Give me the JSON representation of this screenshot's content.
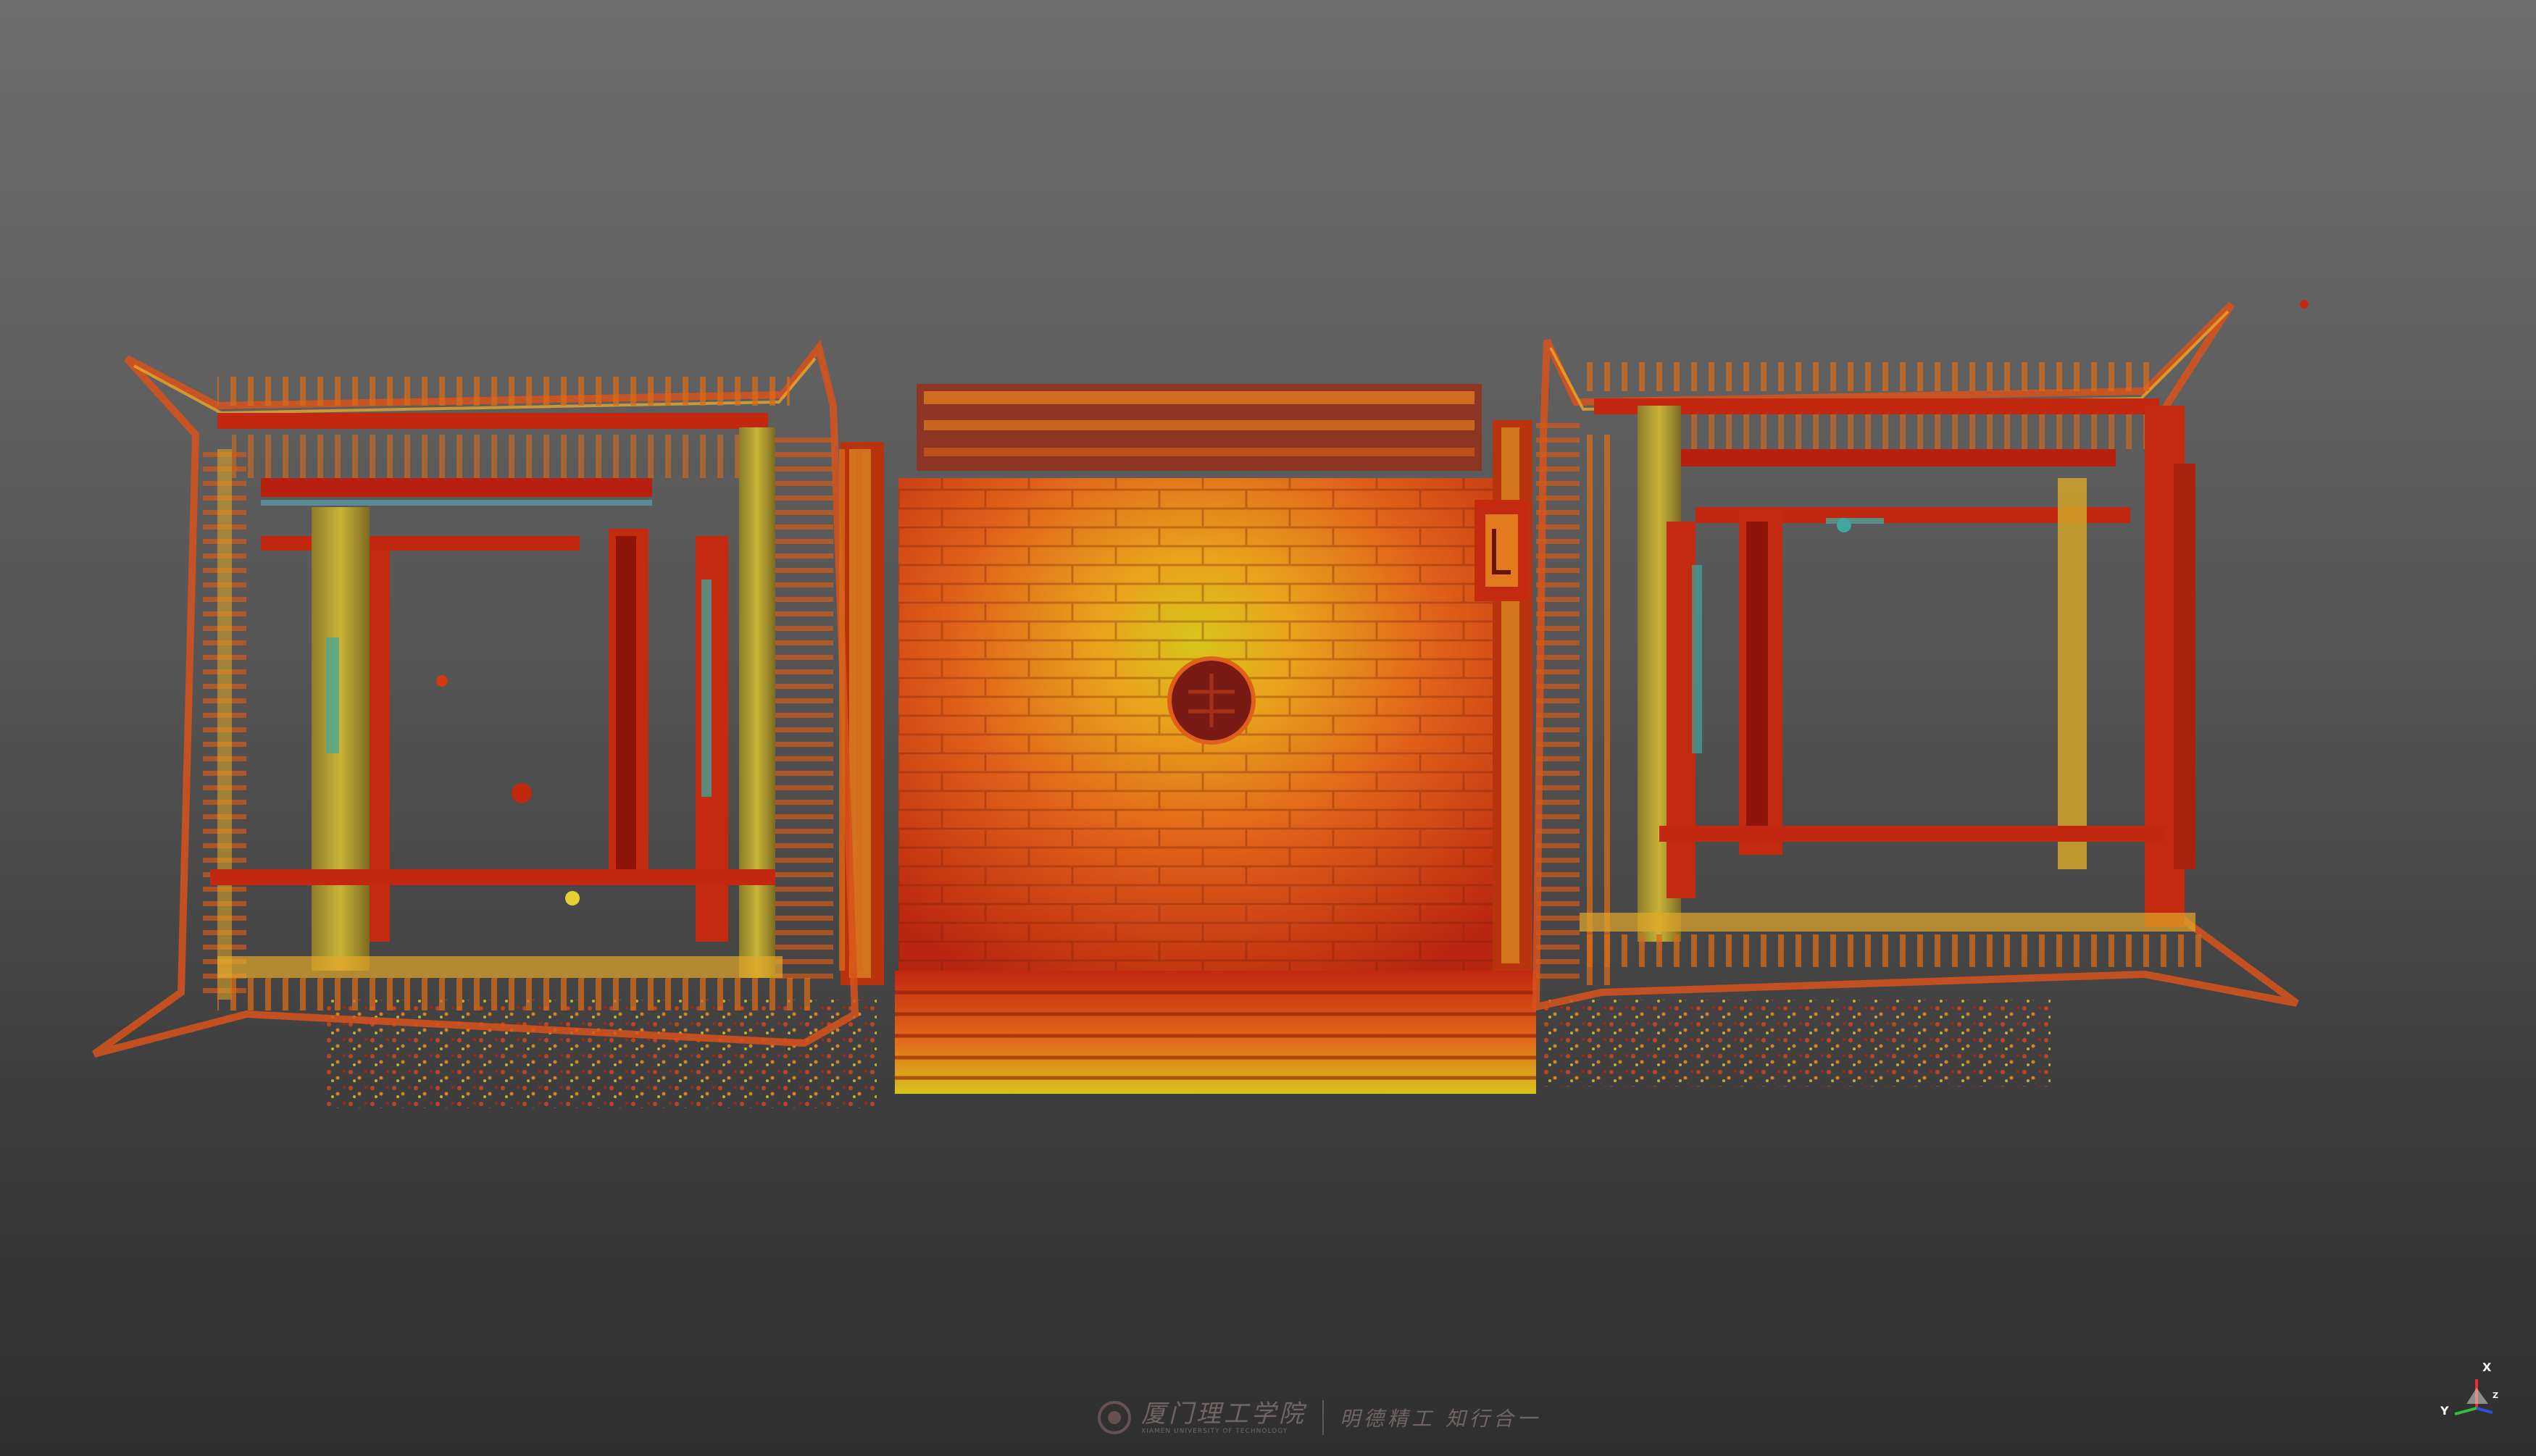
{
  "viewer": {
    "background_top": "#6e6e6e",
    "background_bottom": "#2f2f2f"
  },
  "scene": {
    "colormap": [
      "#8a0c0a",
      "#c81e10",
      "#e8541a",
      "#f2a020",
      "#d8d020",
      "#9bbf3a",
      "#3fa7a0"
    ],
    "central_emblem_color": "#7a1a14"
  },
  "watermark": {
    "name": "厦门理工学院",
    "english": "XIAMEN UNIVERSITY OF TECHNOLOGY",
    "motto": "明德精工 知行合一",
    "icon": "university-seal-icon"
  },
  "axis_gizmo": {
    "x_label": "X",
    "y_label": "Y",
    "z_label": "Z",
    "icon": "axis-triad-icon"
  }
}
